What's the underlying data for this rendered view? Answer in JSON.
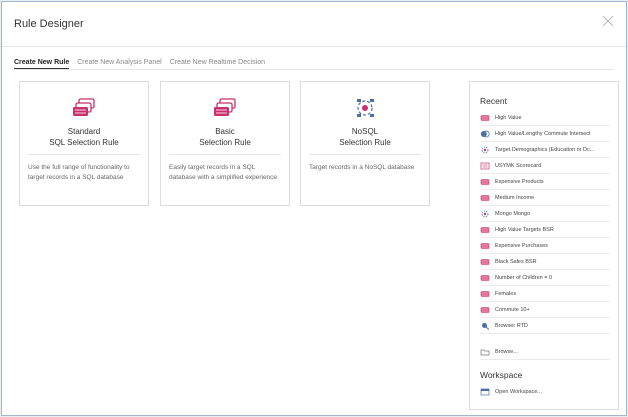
{
  "dialog": {
    "title": "Rule Designer"
  },
  "tabs": [
    {
      "label": "Create New Rule"
    },
    {
      "label": "Create New Analysis Panel"
    },
    {
      "label": "Create New Realtime Decision"
    }
  ],
  "cards": [
    {
      "title_line1": "Standard",
      "title_line2": "SQL Selection Rule",
      "description": "Use the full range of functionality to target records in a SQL database",
      "icon": "stacked-cards-icon"
    },
    {
      "title_line1": "Basic",
      "title_line2": "Selection Rule",
      "description": "Easily target records in a SQL database with a simplified experience",
      "icon": "stacked-cards-icon"
    },
    {
      "title_line1": "NoSQL",
      "title_line2": "Selection Rule",
      "description": "Target records in a NoSQL database",
      "icon": "nosql-cycle-icon"
    }
  ],
  "recent": {
    "heading": "Recent",
    "items": [
      {
        "label": "High Value",
        "icon": "rule-icon"
      },
      {
        "label": "High Value/Lengthy Commute Intersect",
        "icon": "intersect-icon"
      },
      {
        "label": "Target Demographics (Education or Dc...",
        "icon": "nosql-icon"
      },
      {
        "label": "USYMK Scorecard",
        "icon": "scorecard-icon"
      },
      {
        "label": "Expensive Products",
        "icon": "rule-icon"
      },
      {
        "label": "Medium Income",
        "icon": "rule-icon"
      },
      {
        "label": "Mongo Mongo",
        "icon": "nosql-icon"
      },
      {
        "label": "High Value Targets BSR",
        "icon": "rule-icon"
      },
      {
        "label": "Expensive Purchases",
        "icon": "rule-icon"
      },
      {
        "label": "Black Sales BSR",
        "icon": "rule-icon"
      },
      {
        "label": "Number of Children = 0",
        "icon": "rule-icon"
      },
      {
        "label": "Females",
        "icon": "rule-icon"
      },
      {
        "label": "Commute 10+",
        "icon": "rule-icon"
      },
      {
        "label": "Browser RTD",
        "icon": "realtime-icon"
      }
    ],
    "browse_label": "Browse..."
  },
  "workspace": {
    "heading": "Workspace",
    "open_label": "Open Workspace..."
  },
  "colors": {
    "accent": "#c8306e",
    "nosql_blue": "#4a6fa5",
    "border": "#dcdcdc"
  }
}
